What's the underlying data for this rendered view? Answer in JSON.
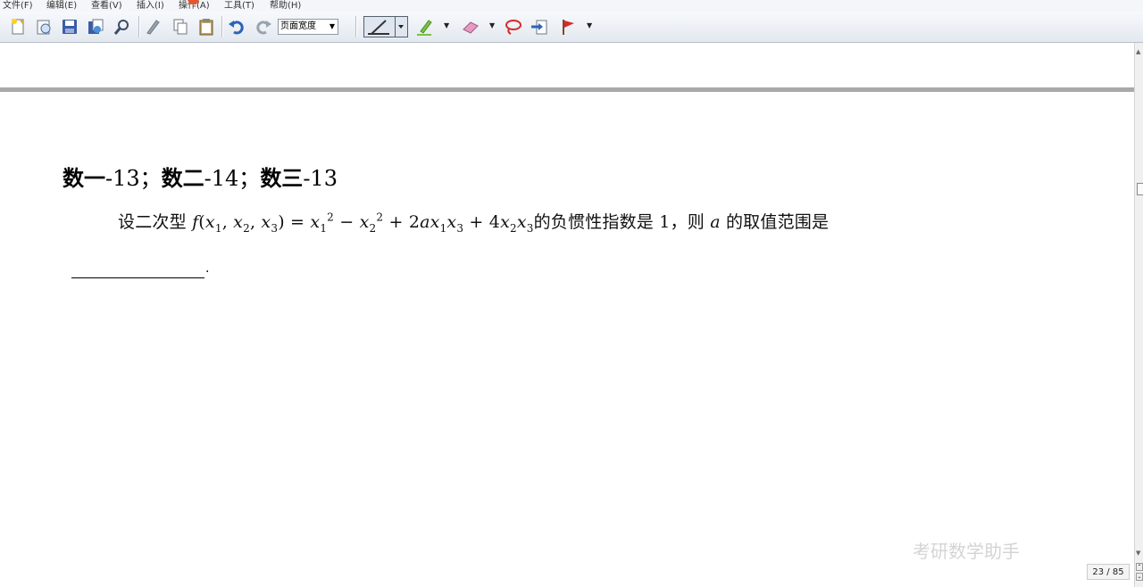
{
  "menu": [
    "文件(F)",
    "编辑(E)",
    "查看(V)",
    "插入(I)",
    "操作(A)",
    "工具(T)",
    "帮助(H)"
  ],
  "toolbar": {
    "zoom_value": "页面宽度",
    "icons": [
      "new-document-icon",
      "open-icon",
      "save-icon",
      "save-as-icon",
      "find-icon",
      "pen-tool-icon",
      "copy-icon",
      "paste-icon",
      "undo-icon",
      "redo-icon",
      "pen-icon",
      "highlighter-icon",
      "eraser-icon",
      "lasso-icon",
      "insert-icon",
      "flag-icon"
    ]
  },
  "document": {
    "heading_parts": [
      "数一",
      "-13；",
      "数二",
      "-14；",
      "数三",
      "-13"
    ],
    "question_prefix": "设二次型",
    "question_suffix": "的负惯性指数是 1，则",
    "question_var": "a",
    "question_end": "的取值范围是",
    "blank_tail": "."
  },
  "status": {
    "page_counter": "23 / 85"
  },
  "watermark": "考研数学助手",
  "colors": {
    "accent_red": "#e4572e",
    "page_border": "#a9a9a9",
    "pen_green": "#7ac143",
    "flag_red": "#d82a2a"
  }
}
